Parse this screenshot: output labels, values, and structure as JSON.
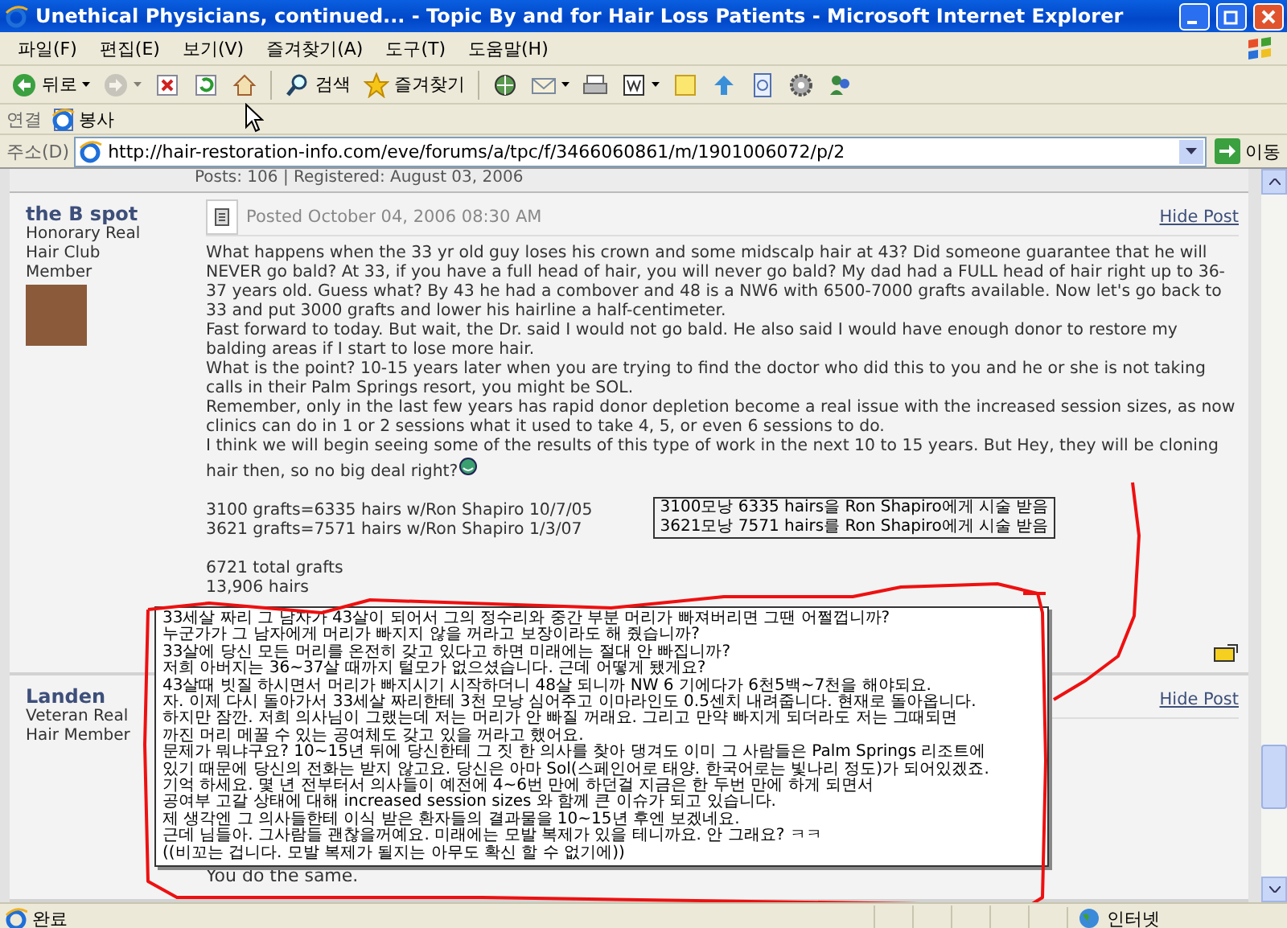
{
  "window": {
    "title": "Unethical Physicians, continued... - Topic By and for Hair Loss Patients - Microsoft Internet Explorer"
  },
  "menu": [
    "파일(F)",
    "편집(E)",
    "보기(V)",
    "즐겨찾기(A)",
    "도구(T)",
    "도움말(H)"
  ],
  "toolbar": [
    {
      "kind": "back",
      "label": "뒤로",
      "disabled": false
    },
    {
      "kind": "forward",
      "disabled": true
    },
    {
      "kind": "stop",
      "disabled": false
    },
    {
      "kind": "refresh",
      "disabled": false
    },
    {
      "kind": "home",
      "disabled": false
    },
    {
      "kind": "search",
      "label": "검색",
      "disabled": false
    },
    {
      "kind": "favorites",
      "label": "즐겨찾기",
      "disabled": false
    },
    {
      "kind": "media",
      "disabled": false
    },
    {
      "kind": "mail",
      "disabled": false
    },
    {
      "kind": "print",
      "disabled": false
    },
    {
      "kind": "edit",
      "disabled": false
    },
    {
      "kind": "note",
      "disabled": false
    },
    {
      "kind": "messenger",
      "disabled": false
    },
    {
      "kind": "research",
      "disabled": false
    },
    {
      "kind": "tools",
      "disabled": false
    },
    {
      "kind": "contacts",
      "disabled": false
    }
  ],
  "links_bar": {
    "label": "연결",
    "links": [
      "봉사"
    ]
  },
  "address_bar": {
    "label": "주소(D)",
    "url": "http://hair-restoration-info.com/eve/forums/a/tpc/f/3466060861/m/1901006072/p/2",
    "go": "이동"
  },
  "page": {
    "profile_strip": "Posts: 106 | Registered: August 03, 2006",
    "posts": [
      {
        "author": "the B spot",
        "rank": "Honorary Real Hair Club Member",
        "avatar": true,
        "posted": "Posted October 04, 2006 08:30 AM",
        "hide": "Hide Post",
        "paragraphs": [
          "What happens when the 33 yr old guy loses his crown and some midscalp hair at 43? Did someone guarantee that he will NEVER go bald? At 33, if you have a full head of hair, you will never go bald? My dad had a FULL head of hair right up to 36-37 years old. Guess what? By 43 he had a combover and 48 is a NW6 with 6500-7000 grafts available. Now let's go back to 33 and put 3000 grafts and lower his hairline a half-centimeter.",
          "Fast forward to today. But wait, the Dr. said I would not go bald. He also said I would have enough donor to restore my balding areas if I start to lose more hair.",
          "What is the point? 10-15 years later when you are trying to find the doctor who did this to you and he or she is not taking calls in their Palm Springs resort, you might be SOL.",
          "Remember, only in the last few years has rapid donor depletion become a real issue with the increased session sizes, as now clinics can do in 1 or 2 sessions what it used to take 4, 5, or even 6 sessions to do.",
          "I think we will begin seeing some of the results of this type of work in the next 10 to 15 years. But Hey, they will be cloning hair then, so no big deal right?"
        ],
        "stats": [
          "3100 grafts=6335 hairs w/Ron Shapiro 10/7/05",
          "3621 grafts=7571 hairs w/Ron Shapiro 1/3/07"
        ],
        "note_box": [
          "3100모낭 6335 hairs을 Ron Shapiro에게 시술 받음",
          "3621모낭 7571 hairs를 Ron Shapiro에게 시술 받음"
        ],
        "totals": [
          "6721 total grafts",
          "13,906 hairs"
        ]
      },
      {
        "author": "Landen",
        "rank": "Veteran Real Hair Member",
        "hide": "Hide Post",
        "paragraphs": [
          "You do the same."
        ]
      }
    ],
    "overlay_note": {
      "lines": [
        "33세살 짜리 그 남자가 43살이 되어서 그의 정수리와 중간 부분 머리가 빠져버리면 그땐 어쩔껍니까?",
        "누군가가 그 남자에게 머리가 빠지지 않을 꺼라고 보장이라도 해 줬습니까?",
        "33살에 당신 모든 머리를 온전히 갖고 있다고 하면 미래에는 절대 안 빠집니까?",
        "저희 아버지는 36~37살 때까지 털모가 없으셨습니다. 근데 어떻게 됐게요?",
        "43살때 빗질 하시면서 머리가 빠지시기 시작하더니 48살 되니까 NW 6 기에다가 6천5백~7천을 해야되요.",
        "자. 이제 다시 돌아가서 33세살 짜리한테 3천 모낭 심어주고 이마라인도 0.5센치 내려줍니다. 현재로 돌아옵니다.",
        "하지만 잠깐. 저희 의사님이 그랬는데 저는 머리가 안 빠질 꺼래요. 그리고 만약 빠지게 되더라도 저는 그때되면",
        "까진 머리 메꿀 수 있는 공여체도 갖고 있을 꺼라고 했어요.",
        "문제가 뭐냐구요? 10~15년 뒤에 당신한테 그 짓 한 의사를 찾아 댕겨도 이미 그 사람들은 Palm Springs 리조트에",
        "있기 때문에 당신의 전화는 받지 않고요. 당신은 아마 Sol(스페인어로 태양. 한국어로는 빛나리 정도)가 되어있겠죠.",
        "기억 하세요. 몇 년 전부터서 의사들이 예전에 4~6번 만에 하던걸 지금은 한 두번 만에 하게 되면서",
        "공여부 고갈 상태에 대해 increased session sizes 와 함께 큰 이슈가 되고 있습니다.",
        "제 생각엔 그 의사들한테 이식 받은 환자들의 결과물을 10~15년 후엔 보겠네요.",
        "근데 님들아. 그사람들 괜찮을꺼예요. 미래에는 모발 복제가 있을 테니까요. 안 그래요? ㅋㅋ",
        "((비꼬는 겁니다. 모발 복제가 될지는 아무도 확신 할 수 없기에))"
      ]
    }
  },
  "status_bar": {
    "text": "완료",
    "zone": "인터넷"
  }
}
